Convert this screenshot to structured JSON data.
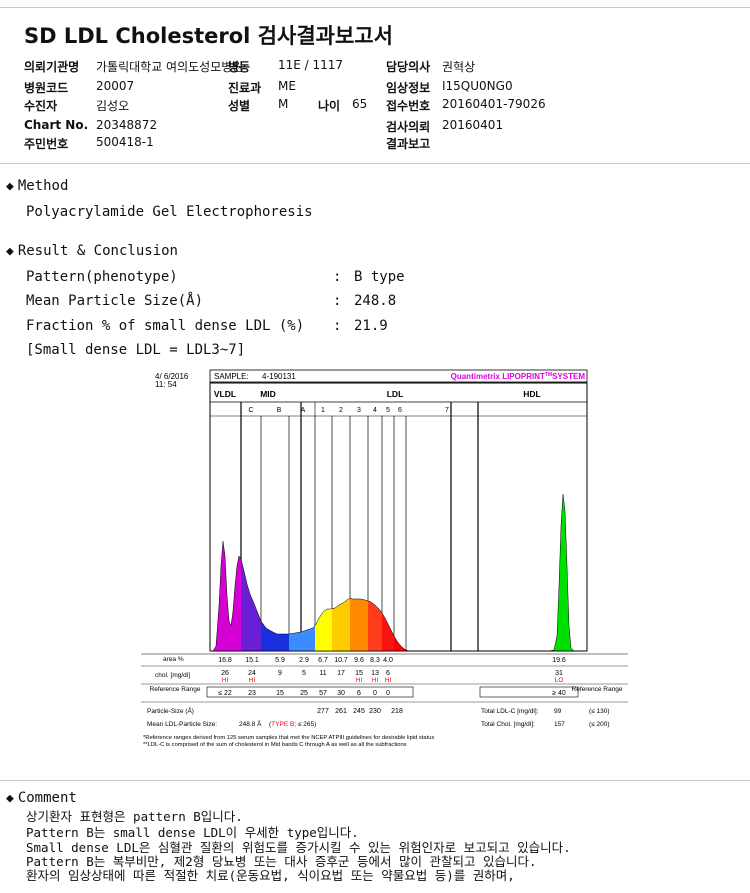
{
  "report_title": "SD LDL Cholesterol 검사결과보고서",
  "header": {
    "institution_label": "의뢰기관명",
    "institution": "가톨릭대학교 여의도성모병원",
    "ward_label": "병동",
    "ward": "11E / 1117",
    "doctor_label": "담당의사",
    "doctor": "권혁상",
    "hospital_code_label": "병원코드",
    "hospital_code": "20007",
    "department_label": "진료과",
    "department": "ME",
    "clinical_info_label": "임상정보",
    "clinical_info": "I15QU0NG0",
    "patient_label": "수진자",
    "patient": "김성오",
    "sex_label": "성별",
    "sex": "M",
    "age_label": "나이",
    "age": "65",
    "receipt_label": "접수번호",
    "receipt": "20160401-79026",
    "chart_no_label": "Chart No.",
    "chart_no": "20348872",
    "request_date_label": "검사의뢰",
    "request_date": "20160401",
    "resident_no_label": "주민번호",
    "resident_no": "500418-1",
    "result_report_label": "결과보고",
    "result_report": ""
  },
  "method": {
    "heading": "Method",
    "text": "Polyacrylamide Gel Electrophoresis"
  },
  "result": {
    "heading": "Result & Conclusion",
    "rows": [
      {
        "label": "Pattern(phenotype)",
        "value": "B type"
      },
      {
        "label": "Mean Particle Size(Å)",
        "value": "248.8"
      },
      {
        "label": "Fraction % of small dense LDL (%)",
        "value": "21.9"
      }
    ],
    "note": "[Small dense LDL = LDL3~7]"
  },
  "chart_data": {
    "type": "area",
    "date": "4/ 6/2016",
    "time": "11: 54",
    "sample_label": "SAMPLE:",
    "sample": "4-190131",
    "brand": "Quantimetrix LIPOPRINT",
    "brand_tm": "TM",
    "brand_suffix": "SYSTEM",
    "groups": [
      "VLDL",
      "MID",
      "LDL",
      "HDL"
    ],
    "bands": [
      "C",
      "B",
      "A",
      "1",
      "2",
      "3",
      "4",
      "5",
      "6",
      "7"
    ],
    "area_label": "area %",
    "area": [
      "16.8",
      "15.1",
      "5.9",
      "2.9",
      "6.7",
      "10.7",
      "9.6",
      "8.3",
      "4.0",
      "19.6"
    ],
    "chol_label": "chol. [mg/dl]",
    "chol": [
      "26",
      "24",
      "9",
      "5",
      "11",
      "17",
      "15",
      "13",
      "6",
      "31"
    ],
    "chol_flags": [
      "HI",
      "HI",
      "",
      "",
      "",
      "",
      "HI",
      "HI",
      "HI",
      "LO"
    ],
    "ref_label": "Reference Range",
    "ref": [
      "≤ 22",
      "23",
      "15",
      "25",
      "57",
      "30",
      "6",
      "0",
      "0",
      "≥ 40"
    ],
    "ref_right_label": "Reference Range",
    "particle_label": "Particle-Size (Å)",
    "particle": [
      "277",
      "261",
      "245",
      "230",
      "218"
    ],
    "total_ldl_label": "Total LDL-C [mg/dl]:",
    "total_ldl": "99",
    "total_ldl_ref": "(≤ 130)",
    "total_chol_label": "Total Chol. [mg/dl]:",
    "total_chol": "157",
    "total_chol_ref": "(≤ 200)",
    "mean_size_label": "Mean LDL-Particle Size:",
    "mean_size": "248.8 Å",
    "type_text": "TYPE B",
    "type_ref": "≤ 265",
    "footnote1": "*Reference ranges derived from 125 serum samples that met the NCEP ATPIII guidelines for desirable lipid status",
    "footnote2": "**LDL-C is comprised of the sum of cholesterol in Mid bands C through A as well as all the subfractions",
    "colors": {
      "vldl": "#d400d4",
      "midc": "#6a1fd6",
      "midb": "#1a30e0",
      "mida": "#3c8cff",
      "ldl1": "#ffff00",
      "ldl2": "#ffcc00",
      "ldl3": "#ff8a00",
      "ldl4": "#ff3d1a",
      "ldl5": "#ff1010",
      "ldl6": "#ff0000",
      "hdl": "#00e000",
      "brand": "#e000e0",
      "flag": "#ff0000",
      "type": "#ff0000"
    }
  },
  "comment": {
    "heading": "Comment",
    "lines": [
      "상기환자 표현형은 pattern B입니다.",
      "Pattern B는 small dense LDL이 우세한 type입니다.",
      "Small dense LDL은 심혈관 질환의 위험도를 증가시킬 수 있는 위험인자로 보고되고 있습니다.",
      "Pattern B는 복부비만, 제2형 당뇨병 또는 대사 증후군 등에서 많이 관찰되고 있습니다.",
      "환자의 임상상태에 따른 적절한 치료(운동요법, 식이요법 또는 약물요법 등)를 권하며,"
    ]
  }
}
